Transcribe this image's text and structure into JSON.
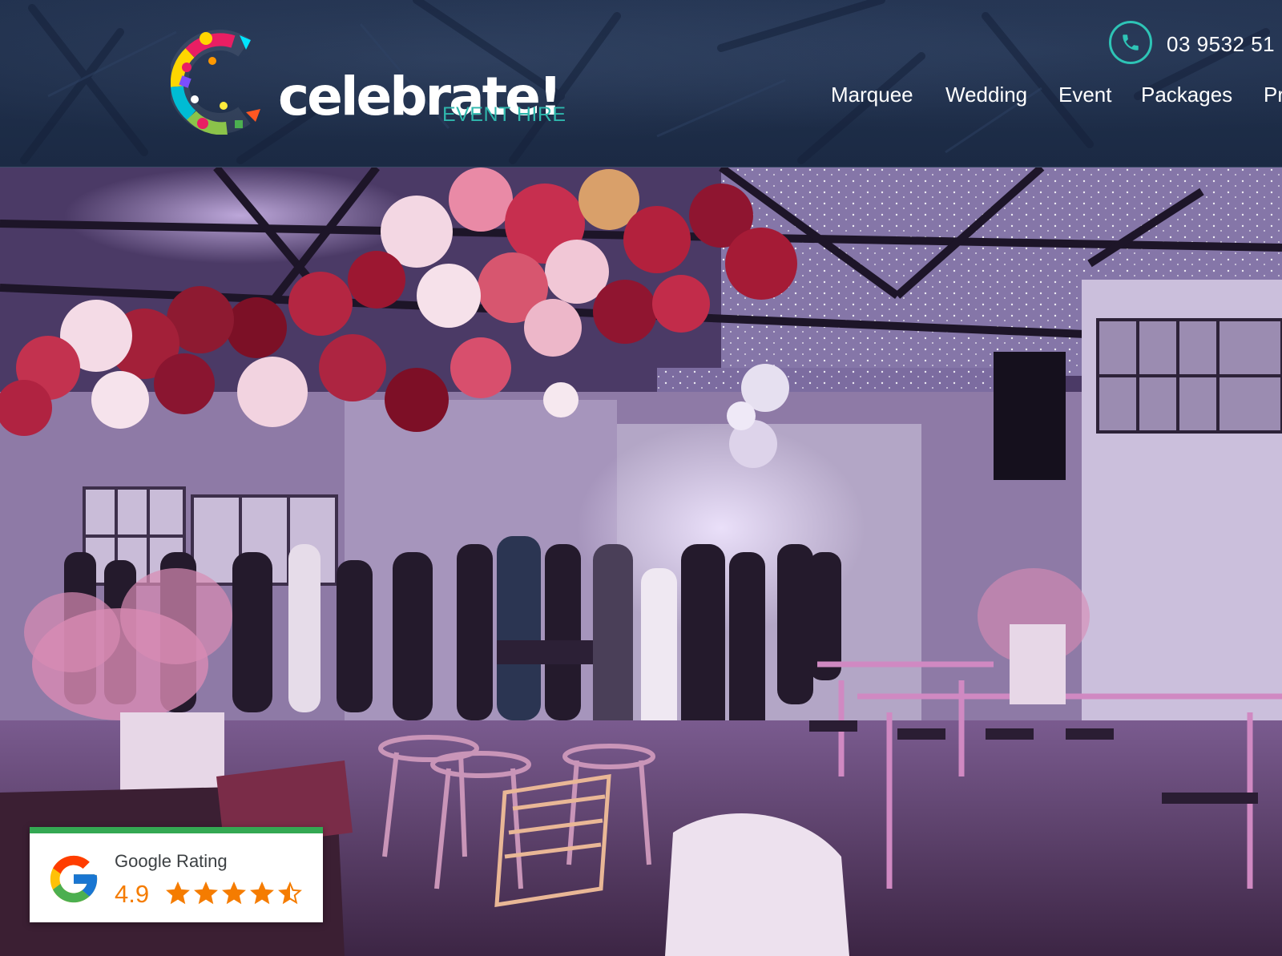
{
  "header": {
    "logo": {
      "wordmark": "celebrate!",
      "subtitle": "EVENT HIRE"
    },
    "phone": {
      "icon": "phone-icon",
      "number": "03 9532 51"
    },
    "nav": [
      {
        "label": "Marquee"
      },
      {
        "label": "Wedding"
      },
      {
        "label": "Event"
      },
      {
        "label": "Packages"
      },
      {
        "label": "Pr"
      }
    ]
  },
  "hero": {
    "image": "event-venue-photo"
  },
  "google_badge": {
    "icon": "google-g-icon",
    "title": "Google Rating",
    "score": "4.9",
    "stars": 4.5,
    "star_color": "#f57c00",
    "accent_color": "#34a853"
  },
  "colors": {
    "header_bg": "#1b2a44",
    "brand_teal": "#2fb7ad"
  }
}
